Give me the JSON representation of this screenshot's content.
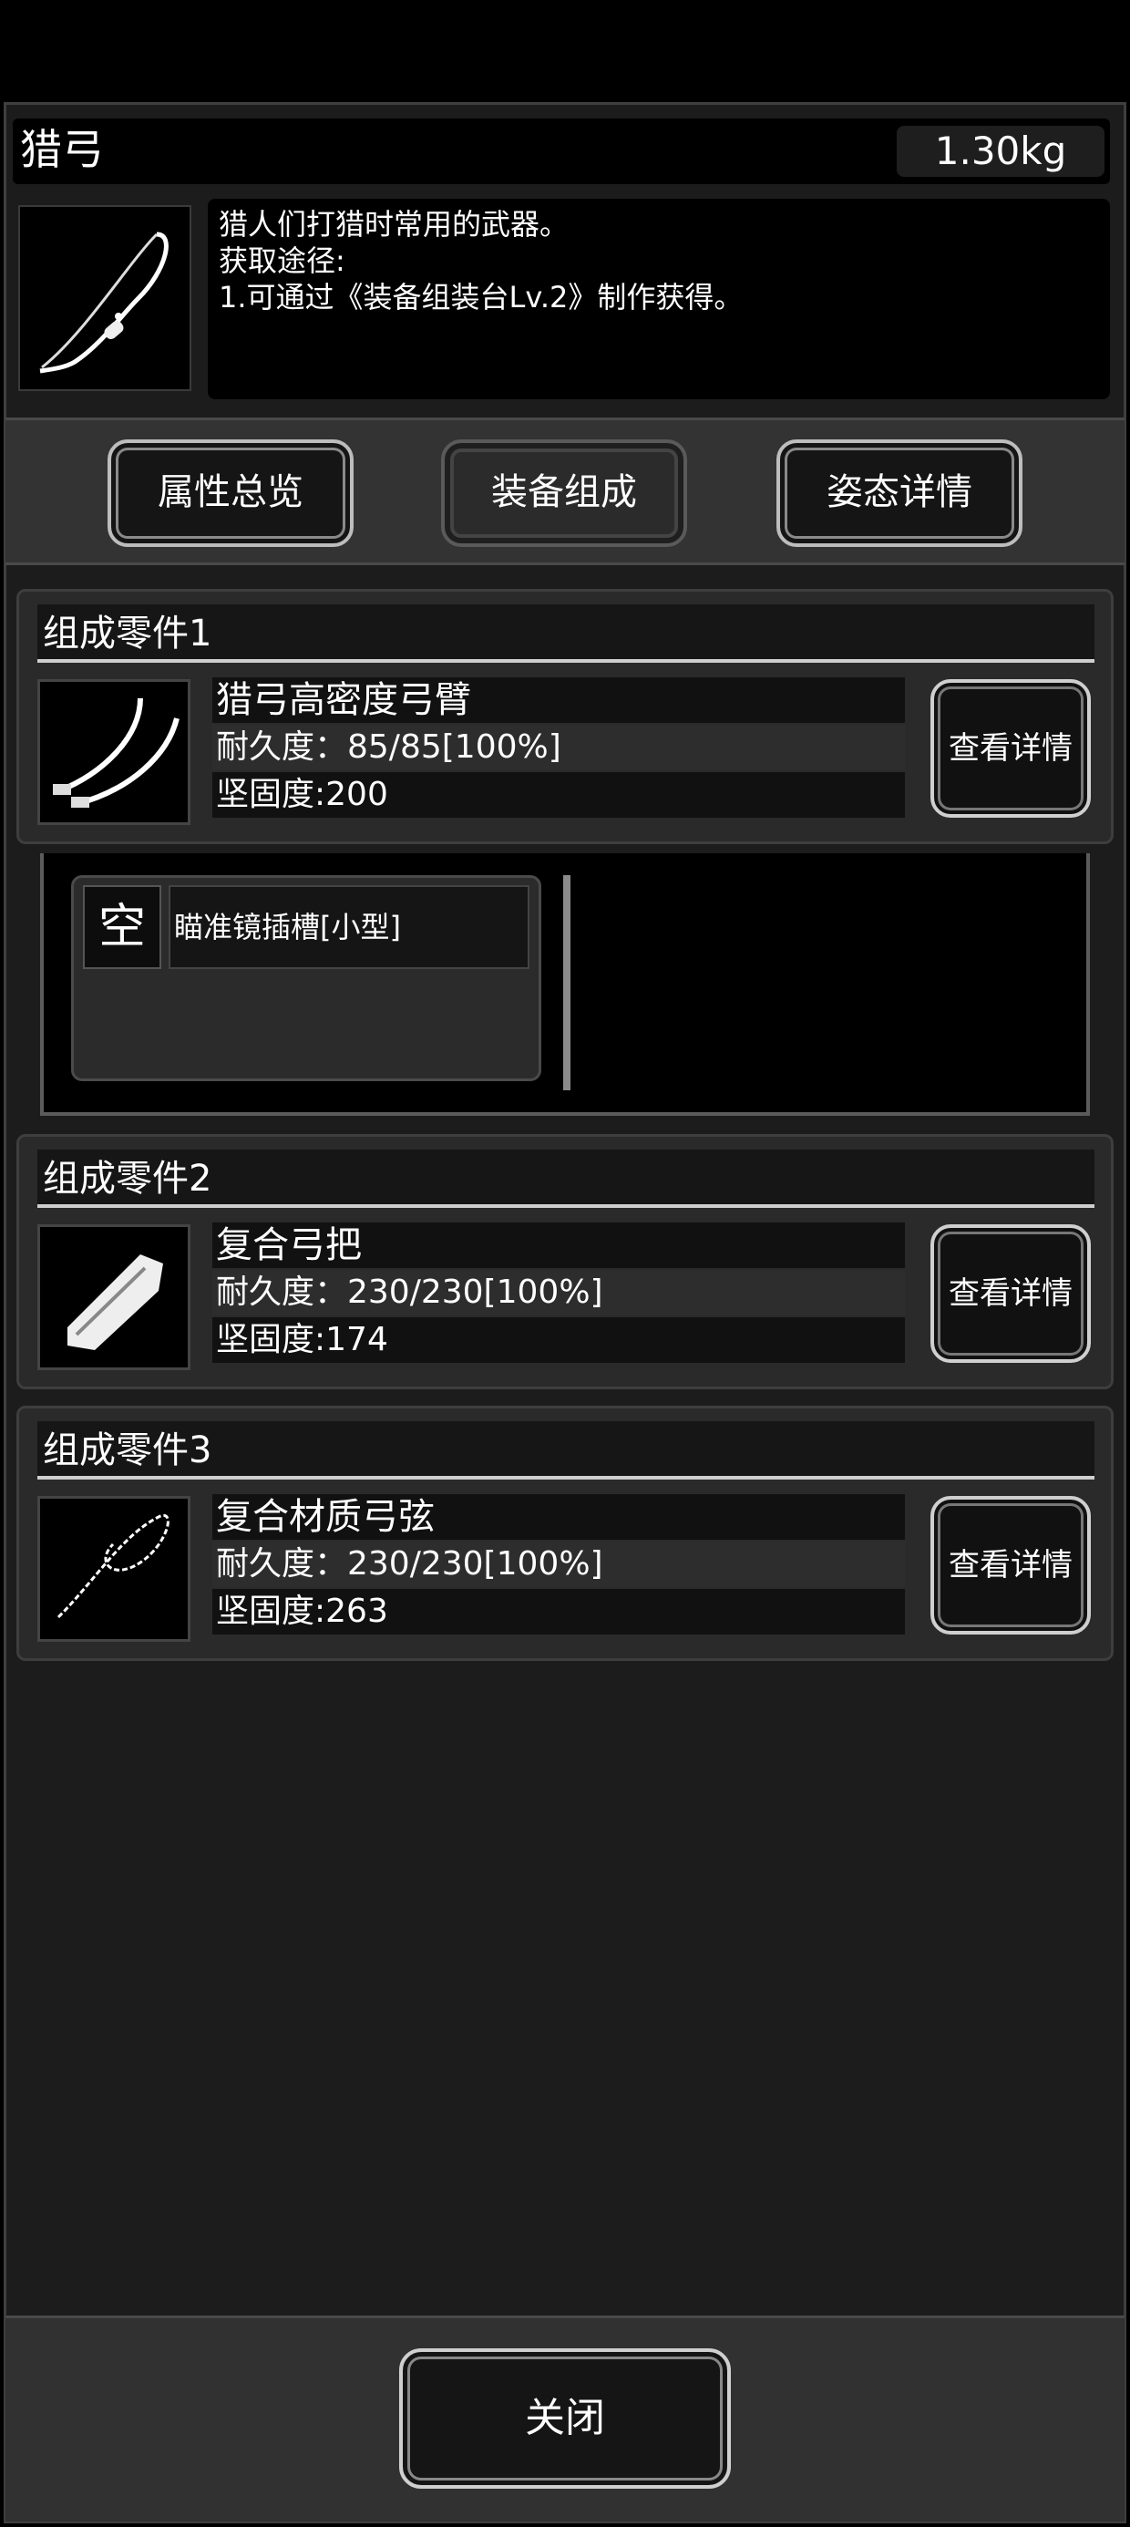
{
  "header": {
    "title": "猎弓",
    "weight": "1.30kg",
    "icon": "bow-icon",
    "description": "猎人们打猎时常用的武器。\n获取途径:\n1.可通过《装备组装台Lv.2》制作获得。"
  },
  "tabs": [
    {
      "label": "属性总览",
      "active": false
    },
    {
      "label": "装备组成",
      "active": true
    },
    {
      "label": "姿态详情",
      "active": false
    }
  ],
  "parts": [
    {
      "header": "组成零件1",
      "name": "猎弓高密度弓臂",
      "durability": "耐久度：85/85[100%]",
      "firmness": "坚固度:200",
      "icon": "bow-limbs-icon",
      "button": "查看详情"
    },
    {
      "header": "组成零件2",
      "name": "复合弓把",
      "durability": "耐久度：230/230[100%]",
      "firmness": "坚固度:174",
      "icon": "bow-grip-icon",
      "button": "查看详情"
    },
    {
      "header": "组成零件3",
      "name": "复合材质弓弦",
      "durability": "耐久度：230/230[100%]",
      "firmness": "坚固度:263",
      "icon": "bowstring-icon",
      "button": "查看详情"
    }
  ],
  "slot": {
    "state": "空",
    "name": "瞄准镜插槽[小型]"
  },
  "footer": {
    "close": "关闭"
  }
}
